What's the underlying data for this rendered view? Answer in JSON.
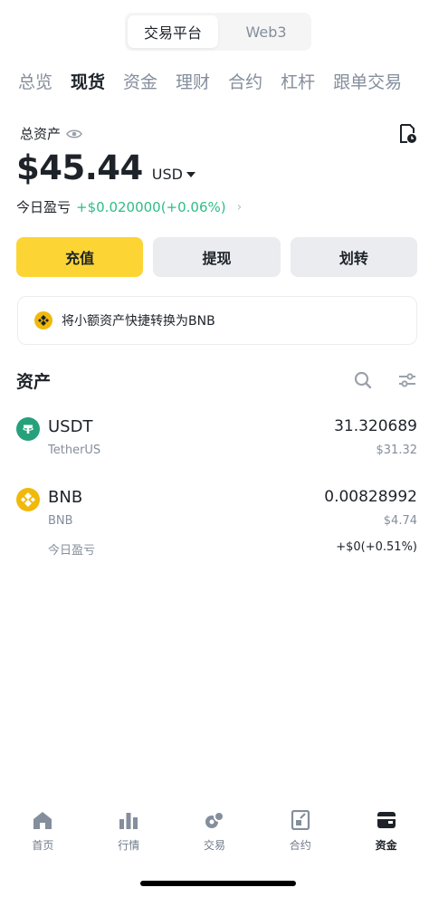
{
  "segment": {
    "items": [
      "交易平台",
      "Web3"
    ],
    "active_index": 0
  },
  "tabs": [
    "总览",
    "现货",
    "资金",
    "理财",
    "合约",
    "杠杆",
    "跟单交易"
  ],
  "active_tab": "现货",
  "summary": {
    "total_label": "总资产",
    "balance": "$45.44",
    "currency": "USD",
    "pnl_label": "今日盈亏",
    "pnl_value": "+$0.020000(+0.06%)"
  },
  "actions": {
    "deposit": "充值",
    "withdraw": "提现",
    "transfer": "划转"
  },
  "promo": {
    "text": "将小额资产快捷转换为BNB"
  },
  "assets": {
    "title": "资产",
    "items": [
      {
        "symbol": "USDT",
        "name": "TetherUS",
        "amount": "31.320689",
        "usd": "$31.32"
      },
      {
        "symbol": "BNB",
        "name": "BNB",
        "amount": "0.00828992",
        "usd": "$4.74",
        "pnl_label": "今日盈亏",
        "pnl_value": "+$0(+0.51%)"
      }
    ]
  },
  "bottom_nav": {
    "items": [
      "首页",
      "行情",
      "交易",
      "合约",
      "资金"
    ],
    "active_index": 4
  },
  "colors": {
    "brand_yellow": "#fcd535",
    "positive_green": "#2ebd85",
    "usdt_teal": "#26a17b",
    "bnb_gold": "#f0b90b"
  },
  "icons": [
    "eye-icon",
    "report-icon",
    "caret-down-icon",
    "chevron-right-icon",
    "bnb-icon",
    "search-icon",
    "filter-icon",
    "usdt-icon",
    "home-icon",
    "markets-icon",
    "trade-icon",
    "futures-icon",
    "wallet-icon"
  ]
}
